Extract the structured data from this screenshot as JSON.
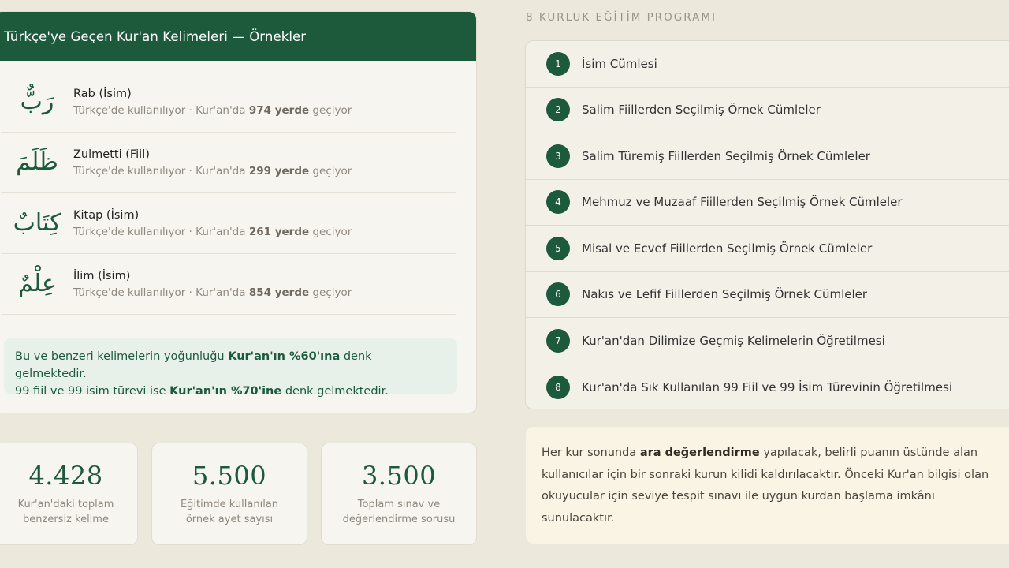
{
  "words_card": {
    "title": "Türkçe'ye Geçen Kur'an Kelimeleri — Örnekler",
    "words": [
      {
        "arabic": "رَبٌّ",
        "name": "Rab (İsim)",
        "meta_prefix": "Türkçe'de kullanılıyor · Kur'an'da",
        "count": "974 yerde",
        "meta_suffix": "geçiyor"
      },
      {
        "arabic": "ظَلَمَ",
        "name": "Zulmetti (Fiil)",
        "meta_prefix": "Türkçe'de kullanılıyor · Kur'an'da",
        "count": "299 yerde",
        "meta_suffix": "geçiyor"
      },
      {
        "arabic": "كِتَابٌ",
        "name": "Kitap (İsim)",
        "meta_prefix": "Türkçe'de kullanılıyor · Kur'an'da",
        "count": "261 yerde",
        "meta_suffix": "geçiyor"
      },
      {
        "arabic": "عِلْمٌ",
        "name": "İlim (İsim)",
        "meta_prefix": "Türkçe'de kullanılıyor · Kur'an'da",
        "count": "854 yerde",
        "meta_suffix": "geçiyor"
      }
    ],
    "density": {
      "line1_pre": "Bu ve benzeri kelimelerin yoğunluğu",
      "line1_bold": "Kur'an'ın %60'ına",
      "line1_post": "denk gelmektedir.",
      "line2_pre": "99 fiil ve 99 isim türevi ise",
      "line2_bold": "Kur'an'ın %70'ine",
      "line2_post": "denk gelmektedir."
    }
  },
  "stats": [
    {
      "value": "4.428",
      "label_line1": "Kur'an'daki toplam",
      "label_line2": "benzersiz kelime"
    },
    {
      "value": "5.500",
      "label_line1": "Eğitimde kullanılan",
      "label_line2": "örnek ayet sayısı"
    },
    {
      "value": "3.500",
      "label_line1": "Toplam sınav ve",
      "label_line2": "değerlendirme sorusu"
    }
  ],
  "program": {
    "title": "8 KURLUK EĞİTİM PROGRAMI",
    "items": [
      {
        "num": "1",
        "label": "İsim Cümlesi"
      },
      {
        "num": "2",
        "label": "Salim Fiillerden Seçilmiş Örnek Cümleler"
      },
      {
        "num": "3",
        "label": "Salim Türemiş Fiillerden Seçilmiş Örnek Cümleler"
      },
      {
        "num": "4",
        "label": "Mehmuz ve Muzaaf Fiillerden Seçilmiş Örnek Cümleler"
      },
      {
        "num": "5",
        "label": "Misal ve Ecvef Fiillerden Seçilmiş Örnek Cümleler"
      },
      {
        "num": "6",
        "label": "Nakıs ve Lefif Fiillerden Seçilmiş Örnek Cümleler"
      },
      {
        "num": "7",
        "label": "Kur'an'dan Dilimize Geçmiş Kelimelerin Öğretilmesi"
      },
      {
        "num": "8",
        "label": "Kur'an'da Sık Kullanılan 99 Fiil ve 99 İsim Türevinin Öğretilmesi"
      }
    ]
  },
  "note": {
    "pre": "Her kur sonunda",
    "bold": "ara değerlendirme",
    "post": "yapılacak, belirli puanın üstünde alan kullanıcılar için bir sonraki kurun kilidi kaldırılacaktır. Önceki Kur'an bilgisi olan okuyucular için seviye tespit sınavı ile uygun kurdan başlama imkânı sunulacaktır."
  },
  "colors": {
    "brand_green": "#1d5a3c",
    "background": "#ede8dc",
    "note_bg": "#faf4e4"
  }
}
